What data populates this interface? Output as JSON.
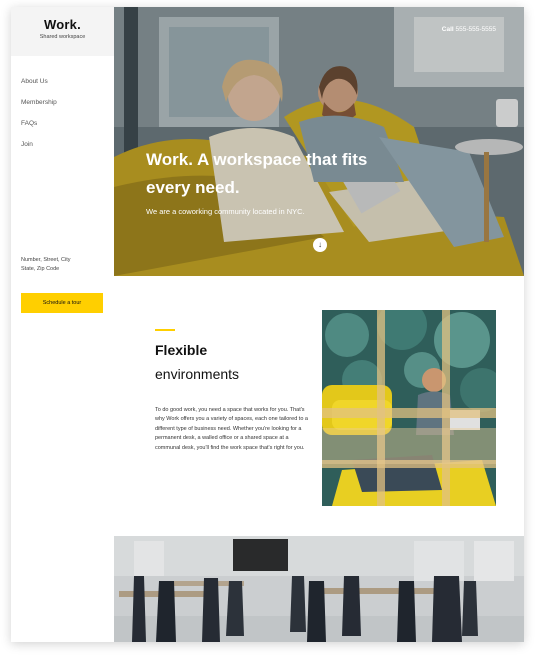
{
  "brand": {
    "name": "Work.",
    "tagline": "Shared workspace"
  },
  "nav": {
    "items": [
      {
        "label": "About Us"
      },
      {
        "label": "Membership"
      },
      {
        "label": "FAQs"
      },
      {
        "label": "Join"
      }
    ]
  },
  "address": {
    "line1": "Number, Street, City",
    "line2": "State, Zip Code"
  },
  "cta": {
    "label": "Schedule a tour"
  },
  "hero": {
    "call_label": "Call",
    "phone": "555-555-5555",
    "title": "Work. A workspace that fits every need.",
    "subtitle": "We are a coworking community located in NYC.",
    "scroll_icon": "arrow-down-icon"
  },
  "feature": {
    "title": "Flexible",
    "subtitle": "environments",
    "body": "To do good work, you need a space that works for you. That's why Work offers you a variety of spaces, each one tailored to a different type of business need. Whether you're looking for a permanent desk, a walled office or a shared space at a communal desk, you'll find the work space that's right for you."
  },
  "colors": {
    "accent": "#ffcf00",
    "sidebar_header_bg": "#f4f4f4",
    "text_dark": "#111111"
  }
}
